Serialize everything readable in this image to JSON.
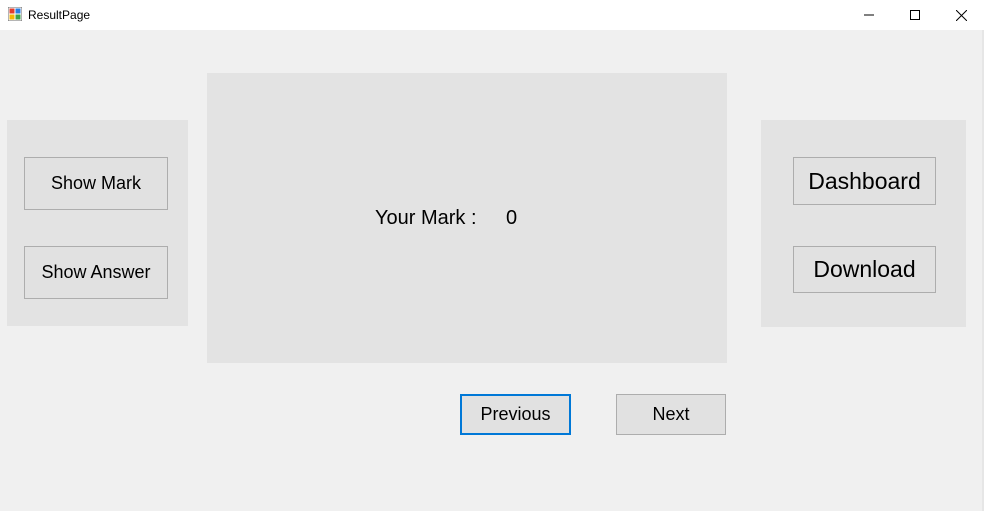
{
  "window": {
    "title": "ResultPage",
    "icon": "windows-forms-app-icon",
    "controls": {
      "minimize_icon": "minimize-icon",
      "maximize_icon": "maximize-icon",
      "close_icon": "close-icon"
    }
  },
  "left_panel": {
    "show_mark_label": "Show Mark",
    "show_answer_label": "Show Answer"
  },
  "center_panel": {
    "mark_label": "Your Mark :",
    "mark_value": "0"
  },
  "right_panel": {
    "dashboard_label": "Dashboard",
    "download_label": "Download"
  },
  "navigation": {
    "previous_label": "Previous",
    "next_label": "Next"
  },
  "colors": {
    "background": "#f0f0f0",
    "panel": "#e3e3e3",
    "button": "#e1e1e1",
    "focus_border": "#0078d7"
  }
}
